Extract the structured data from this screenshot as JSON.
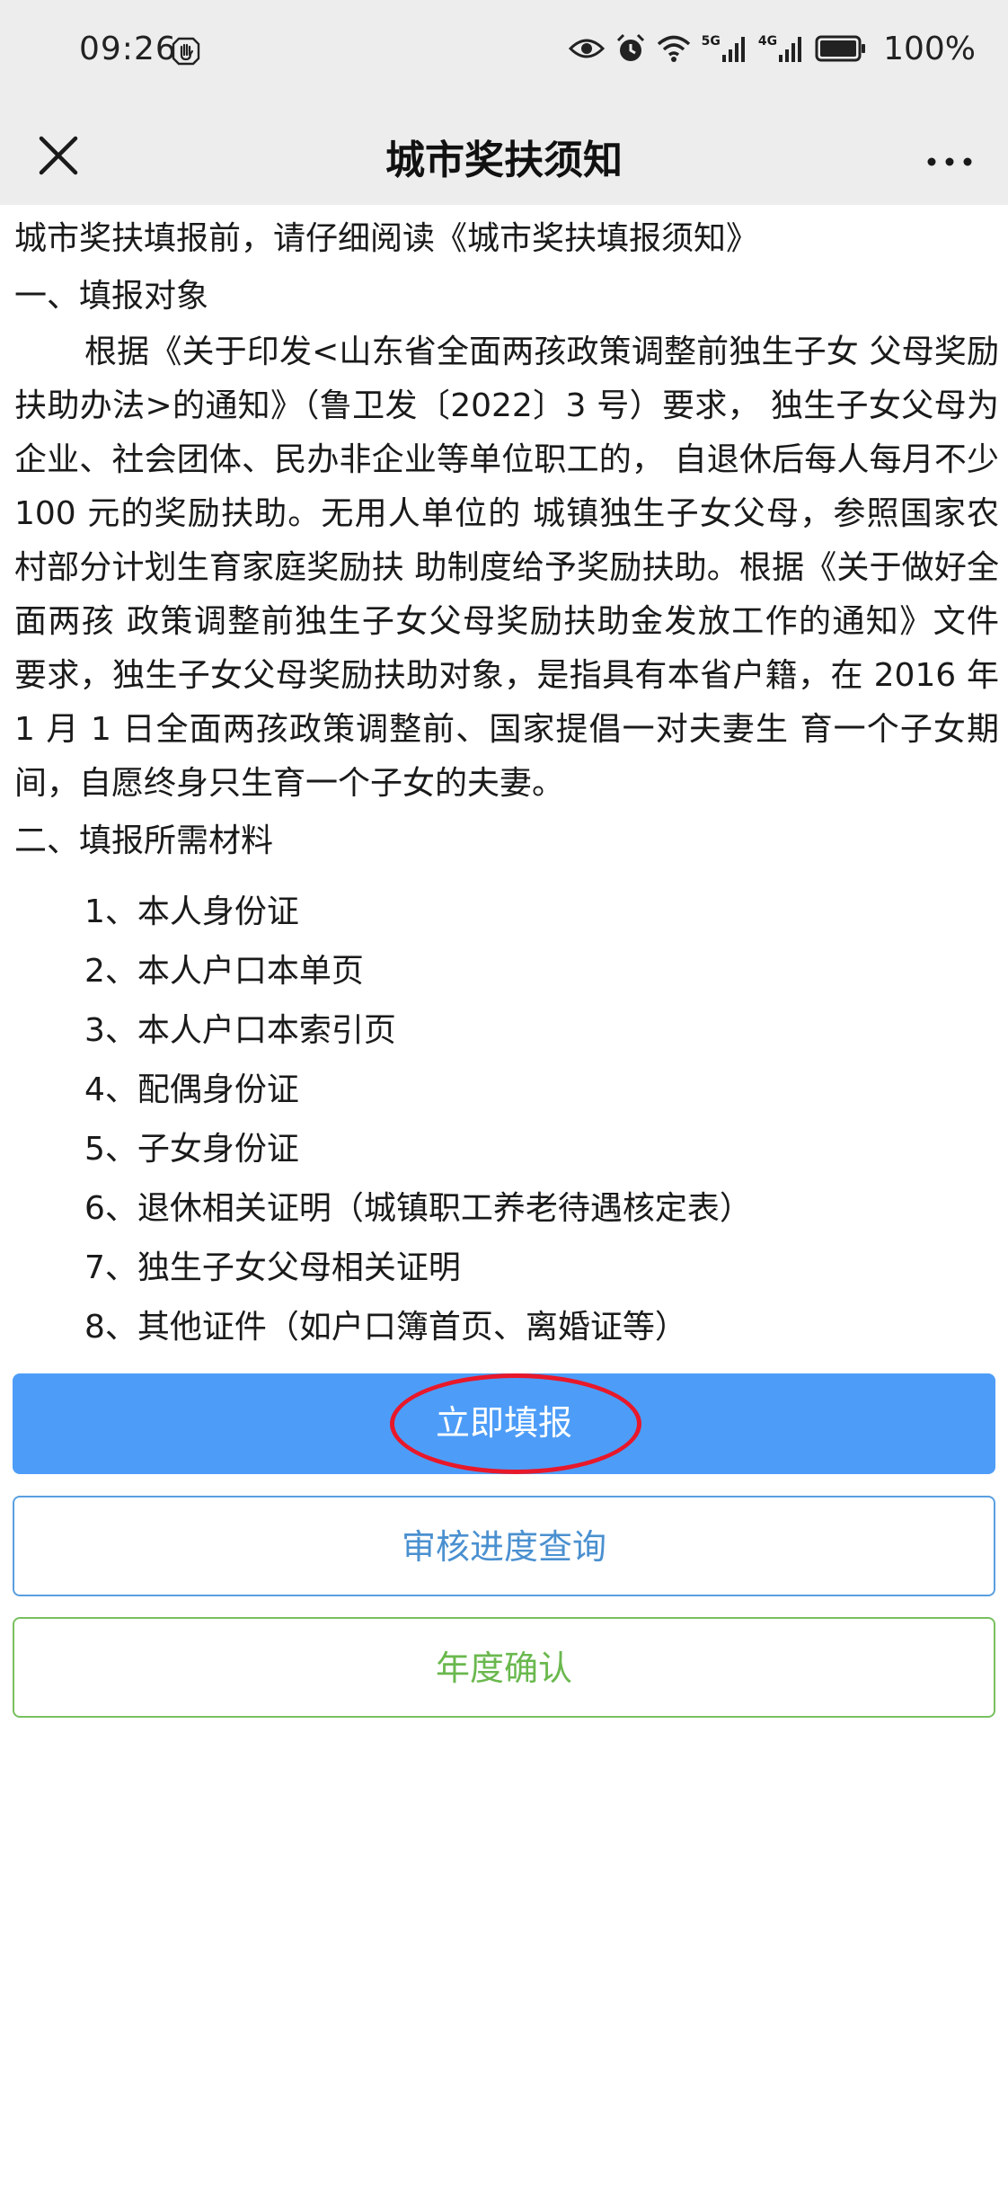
{
  "status_bar": {
    "time": "09:26",
    "network_1": "5G",
    "network_2": "4G",
    "battery": "100%"
  },
  "nav": {
    "title": "城市奖扶须知"
  },
  "content": {
    "intro": "城市奖扶填报前，请仔细阅读《城市奖扶填报须知》",
    "section1_title": "一、填报对象",
    "section1_body": "根据《关于印发<山东省全面两孩政策调整前独生子女 父母奖励扶助办法>的通知》（鲁卫发〔2022〕3 号）要求， 独生子女父母为企业、社会团体、民办非企业等单位职工的， 自退休后每人每月不少 100 元的奖励扶助。无用人单位的 城镇独生子女父母，参照国家农村部分计划生育家庭奖励扶 助制度给予奖励扶助。根据《关于做好全面两孩 政策调整前独生子女父母奖励扶助金发放工作的通知》文件 要求，独生子女父母奖励扶助对象，是指具有本省户籍，在 2016 年 1 月 1 日全面两孩政策调整前、国家提倡一对夫妻生 育一个子女期间，自愿终身只生育一个子女的夫妻。",
    "section2_title": "二、填报所需材料",
    "materials": [
      "1、本人身份证",
      "2、本人户口本单页",
      "3、本人户口本索引页",
      "4、配偶身份证",
      "5、子女身份证",
      "6、退休相关证明（城镇职工养老待遇核定表）",
      "7、独生子女父母相关证明",
      "8、其他证件（如户口簿首页、离婚证等）"
    ]
  },
  "buttons": {
    "submit": "立即填报",
    "progress": "审核进度查询",
    "annual": "年度确认"
  },
  "colors": {
    "primary": "#4d9df8",
    "outline_blue": "#4a90d0",
    "outline_green": "#6ab84e",
    "annotation": "#e8182a"
  }
}
